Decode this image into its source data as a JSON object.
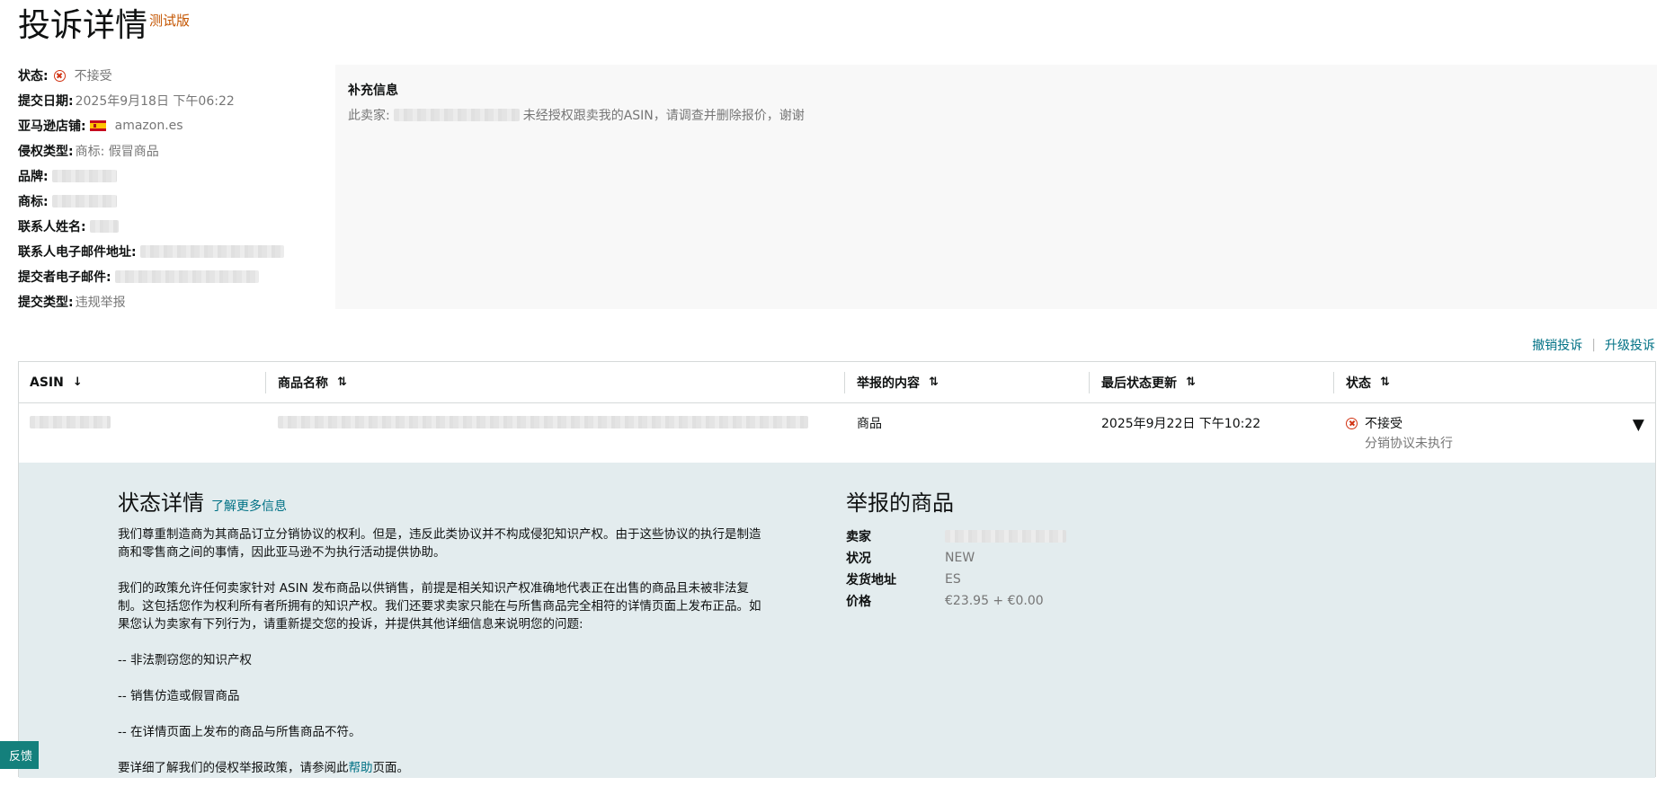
{
  "header": {
    "title": "投诉详情",
    "badge": "测试版"
  },
  "details": {
    "status_label": "状态:",
    "status_value": "不接受",
    "date_label": "提交日期:",
    "date_value": "2025年9月18日 下午06:22",
    "store_label": "亚马逊店铺:",
    "store_value": "amazon.es",
    "type_label": "侵权类型:",
    "type_value": "商标: 假冒商品",
    "brand_label": "品牌:",
    "trademark_label": "商标:",
    "contact_name_label": "联系人姓名:",
    "contact_email_label": "联系人电子邮件地址:",
    "submitter_email_label": "提交者电子邮件:",
    "submit_type_label": "提交类型:",
    "submit_type_value": "违规举报"
  },
  "supplementary": {
    "title": "补充信息",
    "text_prefix": "此卖家:",
    "text_suffix": "未经授权跟卖我的ASIN，请调查并删除报价，谢谢"
  },
  "actions": {
    "withdraw": "撤销投诉",
    "separator": "|",
    "escalate": "升级投诉"
  },
  "table": {
    "headers": {
      "asin": "ASIN",
      "asin_sort": "↓",
      "product_name": "商品名称",
      "reported_content": "举报的内容",
      "last_update": "最后状态更新",
      "status": "状态",
      "sort_glyph": "⇅"
    },
    "row": {
      "reported_content": "商品",
      "last_update": "2025年9月22日 下午10:22",
      "status": "不接受",
      "status_reason": "分销协议未执行",
      "expand_glyph": "▼"
    }
  },
  "status_details": {
    "title": "状态详情",
    "learn_more": "了解更多信息",
    "p1": "我们尊重制造商为其商品订立分销协议的权利。但是，违反此类协议并不构成侵犯知识产权。由于这些协议的执行是制造商和零售商之间的事情，因此亚马逊不为执行活动提供协助。",
    "p2": "我们的政策允许任何卖家针对 ASIN 发布商品以供销售，前提是相关知识产权准确地代表正在出售的商品且未被非法复制。这包括您作为权利所有者所拥有的知识产权。我们还要求卖家只能在与所售商品完全相符的详情页面上发布正品。如果您认为卖家有下列行为，请重新提交您的投诉，并提供其他详细信息来说明您的问题:",
    "b1": "-- 非法剽窃您的知识产权",
    "b2": "-- 销售仿造或假冒商品",
    "b3": "-- 在详情页面上发布的商品与所售商品不符。",
    "footer_prefix": "要详细了解我们的侵权举报政策，请参阅此",
    "footer_link": "帮助",
    "footer_suffix": "页面。"
  },
  "reported_product": {
    "title": "举报的商品",
    "seller_label": "卖家",
    "condition_label": "状况",
    "condition_value": "NEW",
    "ship_from_label": "发货地址",
    "ship_from_value": "ES",
    "price_label": "价格",
    "price_value": "€23.95 + €0.00"
  },
  "feedback": {
    "label": "反馈"
  },
  "colors": {
    "link": "#007185",
    "error": "#d13212",
    "badge": "#c45500",
    "panel": "#e3ecee",
    "feedback": "#14807c"
  }
}
